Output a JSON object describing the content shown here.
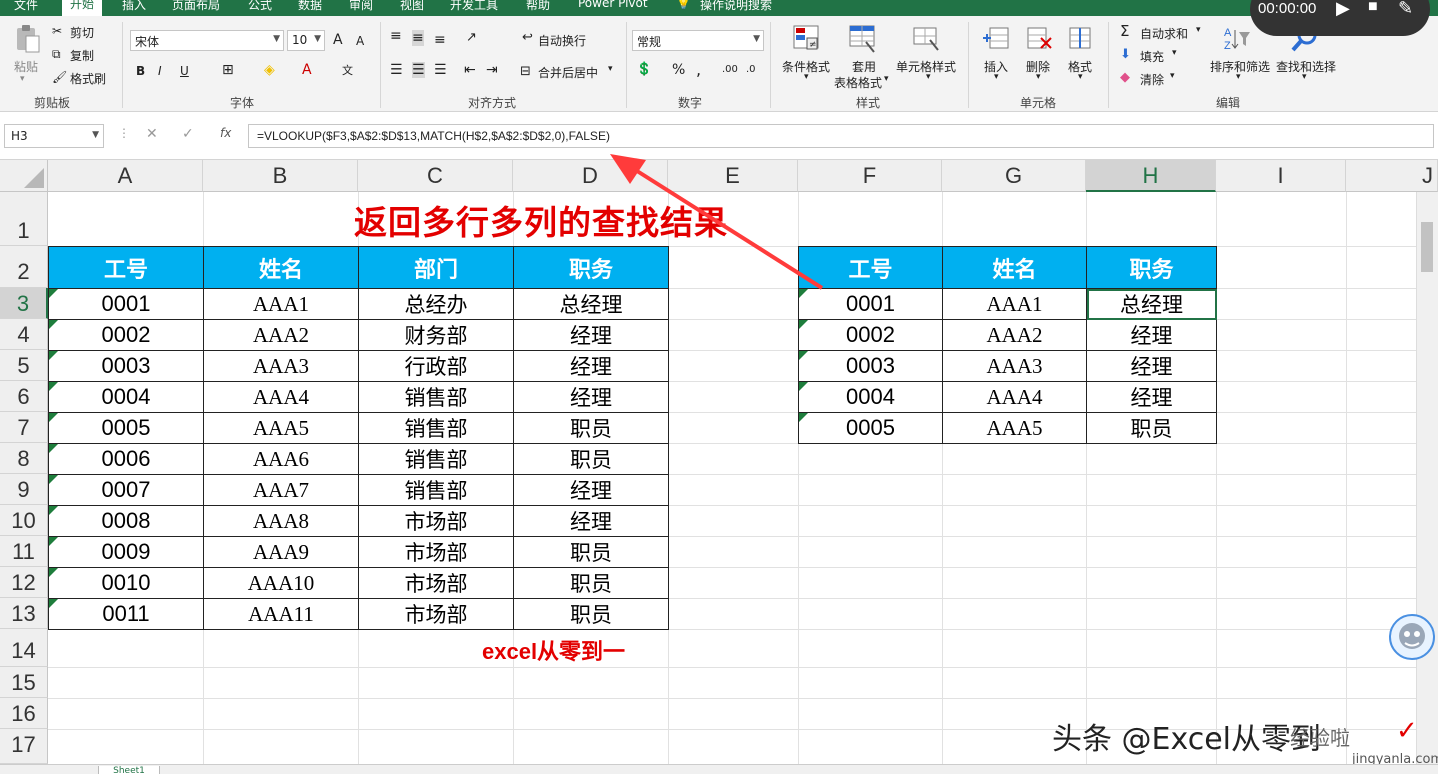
{
  "ribbon": {
    "tabs": [
      "文件",
      "开始",
      "插入",
      "页面布局",
      "公式",
      "数据",
      "审阅",
      "视图",
      "开发工具",
      "帮助",
      "Power Pivot",
      "操作说明搜索"
    ],
    "clipboard": {
      "paste": "粘贴",
      "cut": "剪切",
      "copy": "复制",
      "format_painter": "格式刷",
      "group": "剪贴板"
    },
    "font": {
      "name": "宋体",
      "size": "10",
      "grow": "A",
      "shrink": "A",
      "bold": "B",
      "italic": "I",
      "underline": "U",
      "group": "字体"
    },
    "alignment": {
      "wrap": "自动换行",
      "merge": "合并后居中",
      "group": "对齐方式"
    },
    "number": {
      "format": "常规",
      "percent": "%",
      "comma": ",",
      "group": "数字"
    },
    "styles": {
      "conditional": "条件格式",
      "table_line1": "套用",
      "table_line2": "表格格式",
      "cell_styles": "单元格样式",
      "group": "样式"
    },
    "cells": {
      "insert": "插入",
      "delete": "删除",
      "format": "格式",
      "group": "单元格"
    },
    "editing": {
      "autosum": "自动求和",
      "fill": "填充",
      "clear": "清除",
      "sort": "排序和筛选",
      "find": "查找和选择",
      "group": "编辑"
    },
    "timer": "00:00:00"
  },
  "formula_bar": {
    "name_box": "H3",
    "fx": "fx",
    "formula": "=VLOOKUP($F3,$A$2:$D$13,MATCH(H$2,$A$2:$D$2,0),FALSE)"
  },
  "grid": {
    "columns": [
      "A",
      "B",
      "C",
      "D",
      "E",
      "F",
      "G",
      "H",
      "I",
      "J"
    ],
    "rows": [
      "1",
      "2",
      "3",
      "4",
      "5",
      "6",
      "7",
      "8",
      "9",
      "10",
      "11",
      "12",
      "13",
      "14",
      "15",
      "16",
      "17"
    ]
  },
  "title": "返回多行多列的查找结果",
  "subnote": "excel从零到一",
  "left_table": {
    "headers": [
      "工号",
      "姓名",
      "部门",
      "职务"
    ],
    "rows": [
      [
        "0001",
        "AAA1",
        "总经办",
        "总经理"
      ],
      [
        "0002",
        "AAA2",
        "财务部",
        "经理"
      ],
      [
        "0003",
        "AAA3",
        "行政部",
        "经理"
      ],
      [
        "0004",
        "AAA4",
        "销售部",
        "经理"
      ],
      [
        "0005",
        "AAA5",
        "销售部",
        "职员"
      ],
      [
        "0006",
        "AAA6",
        "销售部",
        "职员"
      ],
      [
        "0007",
        "AAA7",
        "销售部",
        "经理"
      ],
      [
        "0008",
        "AAA8",
        "市场部",
        "经理"
      ],
      [
        "0009",
        "AAA9",
        "市场部",
        "职员"
      ],
      [
        "0010",
        "AAA10",
        "市场部",
        "职员"
      ],
      [
        "0011",
        "AAA11",
        "市场部",
        "职员"
      ]
    ]
  },
  "right_table": {
    "headers": [
      "工号",
      "姓名",
      "职务"
    ],
    "rows": [
      [
        "0001",
        "AAA1",
        "总经理"
      ],
      [
        "0002",
        "AAA2",
        "经理"
      ],
      [
        "0003",
        "AAA3",
        "经理"
      ],
      [
        "0004",
        "AAA4",
        "经理"
      ],
      [
        "0005",
        "AAA5",
        "职员"
      ]
    ]
  },
  "watermark": {
    "main": "头条 @Excel从零到",
    "site": "经验啦",
    "url": "jingyanla.com"
  },
  "sheet_tab": "Sheet1",
  "colors": {
    "ribbon_green": "#217346",
    "header_fill": "#00b0f0",
    "title_red": "#e30000"
  }
}
